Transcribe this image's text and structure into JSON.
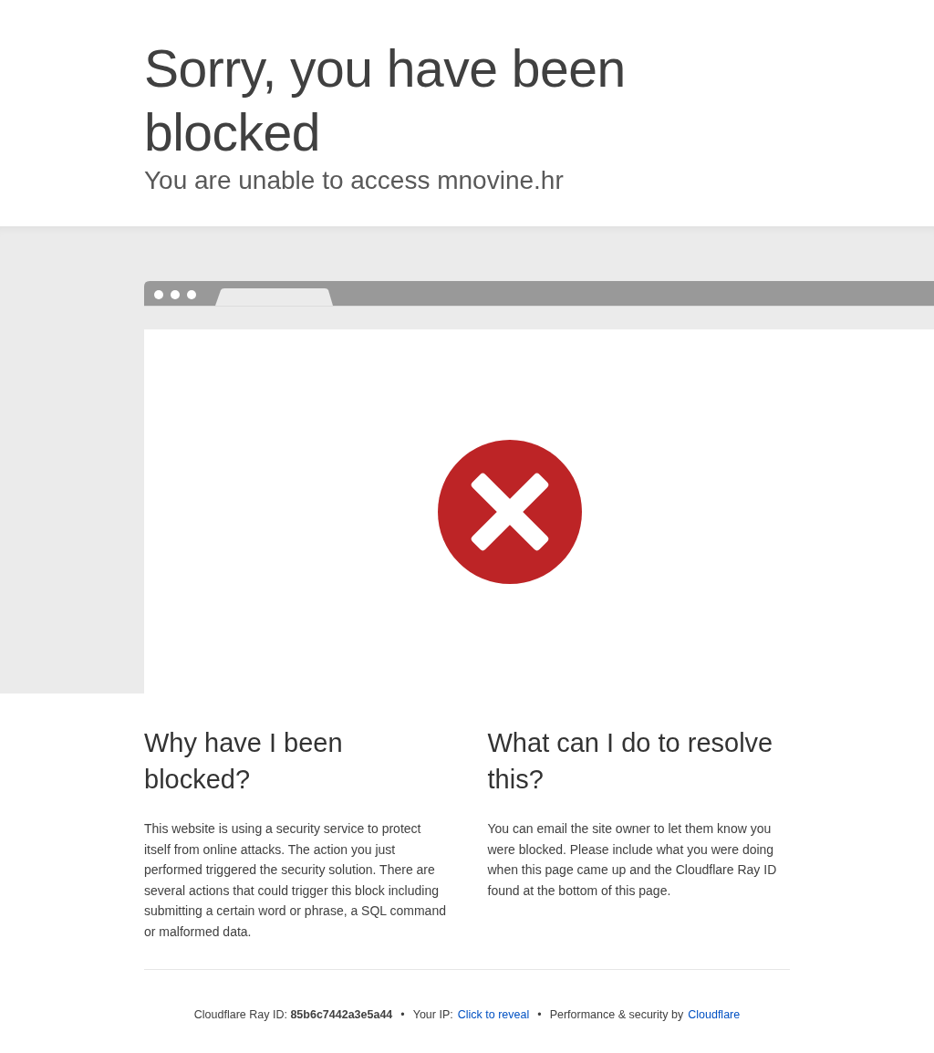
{
  "header": {
    "title": "Sorry, you have been blocked",
    "subtitle": "You are unable to access mnovine.hr"
  },
  "columns": [
    {
      "heading": "Why have I been blocked?",
      "text": "This website is using a security service to protect itself from online attacks. The action you just performed triggered the security solution. There are several actions that could trigger this block including submitting a certain word or phrase, a SQL command or malformed data."
    },
    {
      "heading": "What can I do to resolve this?",
      "text": "You can email the site owner to let them know you were blocked. Please include what you were doing when this page came up and the Cloudflare Ray ID found at the bottom of this page."
    }
  ],
  "footer": {
    "ray_id": "Cloudflare Ray ID: **85b6c7442a3e5a44**",
    "separator_1": "•",
    "ip_label": "Your IP:",
    "ip_link": "Click to reveal",
    "separator_2": "•",
    "performance": "Performance & security by",
    "cloudflare_link": "Cloudflare"
  }
}
